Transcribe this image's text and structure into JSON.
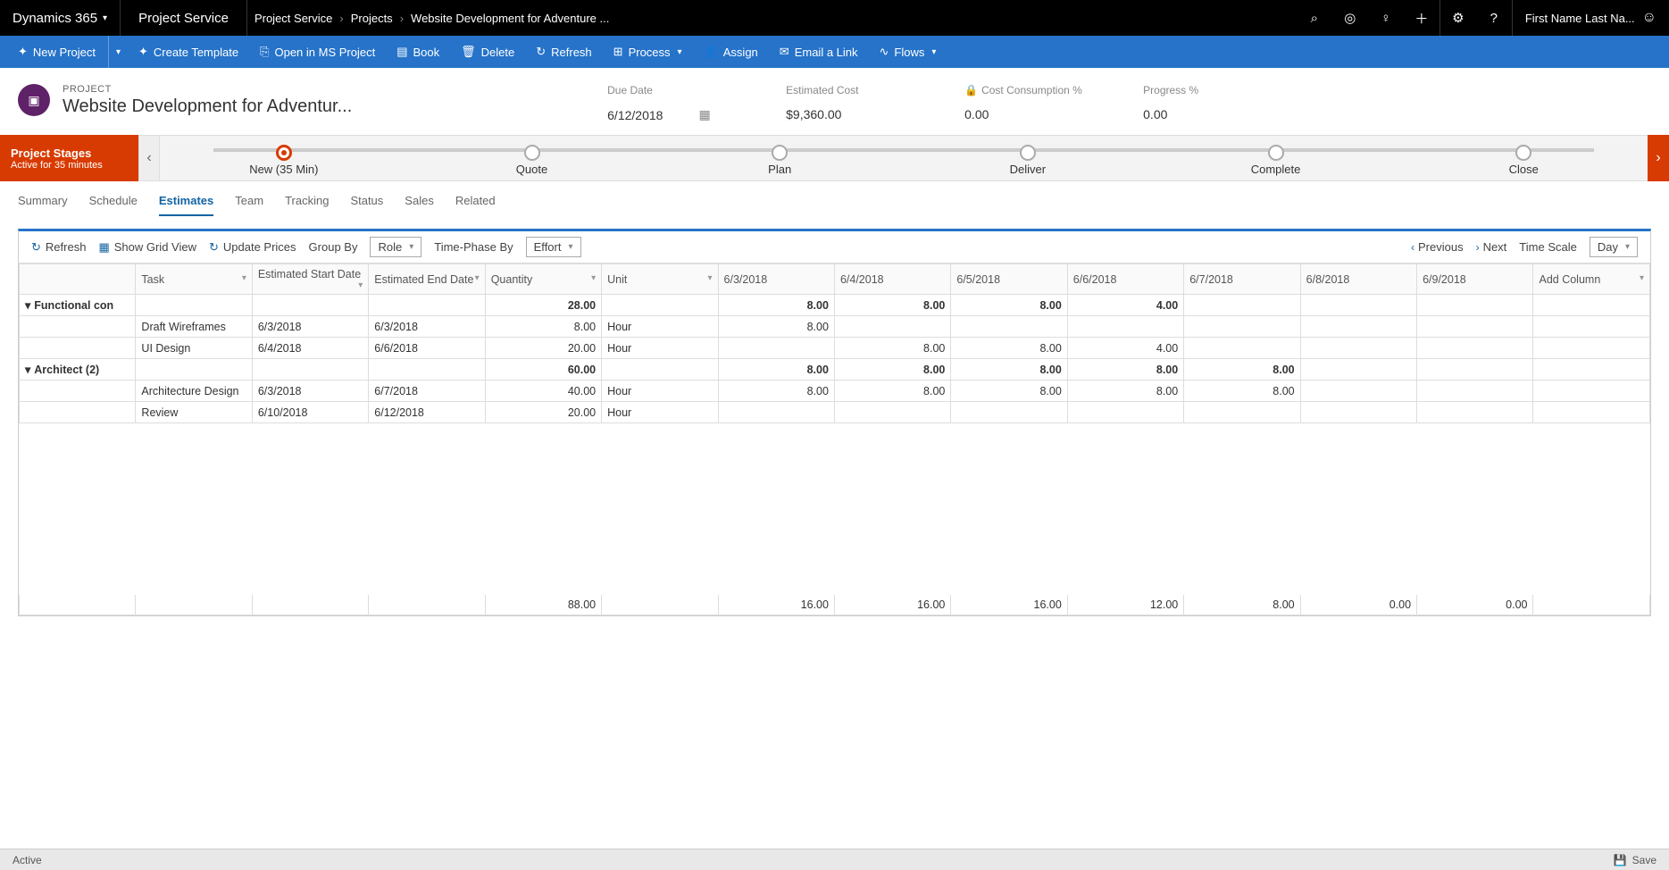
{
  "topbar": {
    "brand": "Dynamics 365",
    "app": "Project Service",
    "breadcrumb": [
      "Project Service",
      "Projects",
      "Website Development for Adventure ..."
    ],
    "user": "First Name Last Na..."
  },
  "commands": {
    "new_project": "New Project",
    "create_template": "Create Template",
    "open_ms": "Open in MS Project",
    "book": "Book",
    "delete": "Delete",
    "refresh": "Refresh",
    "process": "Process",
    "assign": "Assign",
    "email": "Email a Link",
    "flows": "Flows"
  },
  "header": {
    "entity_type": "PROJECT",
    "title": "Website Development for Adventur...",
    "due_date_label": "Due Date",
    "due_date": "6/12/2018",
    "est_cost_label": "Estimated Cost",
    "est_cost": "$9,360.00",
    "cost_cons_label": "Cost Consumption %",
    "cost_cons": "0.00",
    "progress_label": "Progress %",
    "progress": "0.00"
  },
  "stages": {
    "label_title": "Project Stages",
    "label_sub": "Active for 35 minutes",
    "items": [
      "New  (35 Min)",
      "Quote",
      "Plan",
      "Deliver",
      "Complete",
      "Close"
    ]
  },
  "tabs": [
    "Summary",
    "Schedule",
    "Estimates",
    "Team",
    "Tracking",
    "Status",
    "Sales",
    "Related"
  ],
  "active_tab": "Estimates",
  "grid_toolbar": {
    "refresh": "Refresh",
    "show_grid": "Show Grid View",
    "update_prices": "Update Prices",
    "group_by_label": "Group By",
    "group_by_value": "Role",
    "time_phase_label": "Time-Phase By",
    "time_phase_value": "Effort",
    "previous": "Previous",
    "next": "Next",
    "time_scale_label": "Time Scale",
    "time_scale_value": "Day"
  },
  "columns": {
    "task": "Task",
    "est_start": "Estimated Start Date",
    "est_end": "Estimated End Date",
    "quantity": "Quantity",
    "unit": "Unit",
    "add_column": "Add Column",
    "dates": [
      "6/3/2018",
      "6/4/2018",
      "6/5/2018",
      "6/6/2018",
      "6/7/2018",
      "6/8/2018",
      "6/9/2018"
    ]
  },
  "rows": {
    "group1_name": "Functional con",
    "group1_qty": "28.00",
    "group1_d": [
      "8.00",
      "8.00",
      "8.00",
      "4.00",
      "",
      "",
      ""
    ],
    "r1_task": "Draft Wireframes",
    "r1_start": "6/3/2018",
    "r1_end": "6/3/2018",
    "r1_qty": "8.00",
    "r1_unit": "Hour",
    "r1_d": [
      "8.00",
      "",
      "",
      "",
      "",
      "",
      ""
    ],
    "r2_task": "UI Design",
    "r2_start": "6/4/2018",
    "r2_end": "6/6/2018",
    "r2_qty": "20.00",
    "r2_unit": "Hour",
    "r2_d": [
      "",
      "8.00",
      "8.00",
      "4.00",
      "",
      "",
      ""
    ],
    "group2_name": "Architect (2)",
    "group2_qty": "60.00",
    "group2_d": [
      "8.00",
      "8.00",
      "8.00",
      "8.00",
      "8.00",
      "",
      ""
    ],
    "r3_task": "Architecture Design",
    "r3_start": "6/3/2018",
    "r3_end": "6/7/2018",
    "r3_qty": "40.00",
    "r3_unit": "Hour",
    "r3_d": [
      "8.00",
      "8.00",
      "8.00",
      "8.00",
      "8.00",
      "",
      ""
    ],
    "r4_task": "Review",
    "r4_start": "6/10/2018",
    "r4_end": "6/12/2018",
    "r4_qty": "20.00",
    "r4_unit": "Hour",
    "r4_d": [
      "",
      "",
      "",
      "",
      "",
      "",
      ""
    ]
  },
  "totals": {
    "qty": "88.00",
    "d": [
      "16.00",
      "16.00",
      "16.00",
      "12.00",
      "8.00",
      "0.00",
      "0.00"
    ]
  },
  "statusbar": {
    "status": "Active",
    "save": "Save"
  }
}
